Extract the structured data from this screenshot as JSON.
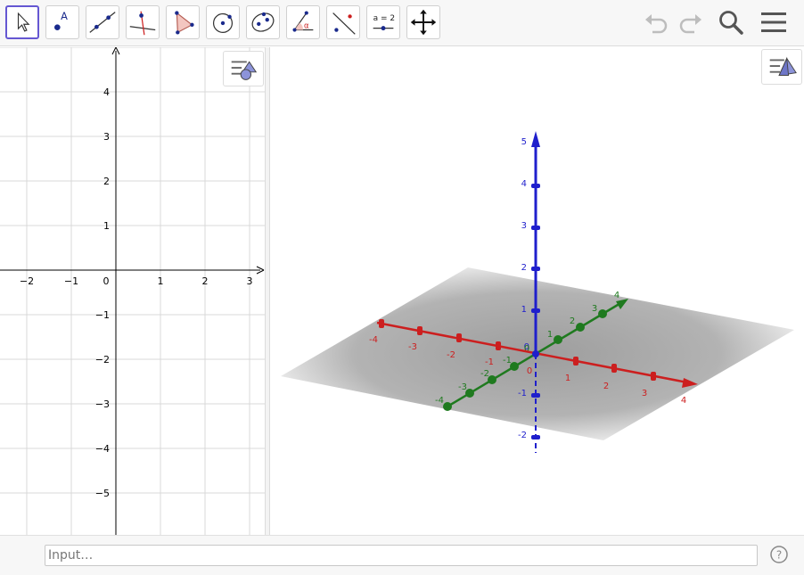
{
  "toolbar": {
    "tools": [
      {
        "name": "move",
        "label": "Move"
      },
      {
        "name": "point",
        "label": "Point",
        "glyph": "A"
      },
      {
        "name": "line",
        "label": "Line"
      },
      {
        "name": "perpendicular-line",
        "label": "Perpendicular Line"
      },
      {
        "name": "polygon",
        "label": "Polygon"
      },
      {
        "name": "circle",
        "label": "Circle with Center through Point"
      },
      {
        "name": "ellipse",
        "label": "Ellipse"
      },
      {
        "name": "angle",
        "label": "Angle",
        "glyph": "α"
      },
      {
        "name": "reflect",
        "label": "Reflect about Line"
      },
      {
        "name": "slider",
        "label": "Slider",
        "glyph": "a = 2"
      },
      {
        "name": "move-graphics",
        "label": "Move Graphics View"
      }
    ],
    "active_tool": "move",
    "icons": {
      "undo": "undo-icon",
      "redo": "redo-icon",
      "search": "search-icon",
      "menu": "menu-icon"
    }
  },
  "graphics_2d": {
    "x_tick_labels": [
      "−2",
      "−1",
      "0",
      "1",
      "2",
      "3"
    ],
    "y_tick_labels": [
      "4",
      "3",
      "2",
      "1",
      "−1",
      "−2",
      "−3",
      "−4",
      "−5"
    ]
  },
  "graphics_3d": {
    "x_axis_labels": [
      "-4",
      "-3",
      "-2",
      "-1",
      "0",
      "1",
      "2",
      "3",
      "4"
    ],
    "y_axis_labels": [
      "-4",
      "-3",
      "-2",
      "-1",
      "0",
      "1",
      "2",
      "3",
      "4"
    ],
    "z_axis_labels": [
      "5",
      "4",
      "3",
      "2",
      "1",
      "0",
      "-1",
      "-2"
    ],
    "colors": {
      "x_axis": "#cc1f1f",
      "y_axis": "#1f7a1f",
      "z_axis": "#1f1fcc",
      "plane": "#b3b3b3"
    }
  },
  "input_bar": {
    "placeholder": "Input…"
  },
  "colors": {
    "accent": "#6557d2",
    "grid": "#d8d8d8"
  }
}
